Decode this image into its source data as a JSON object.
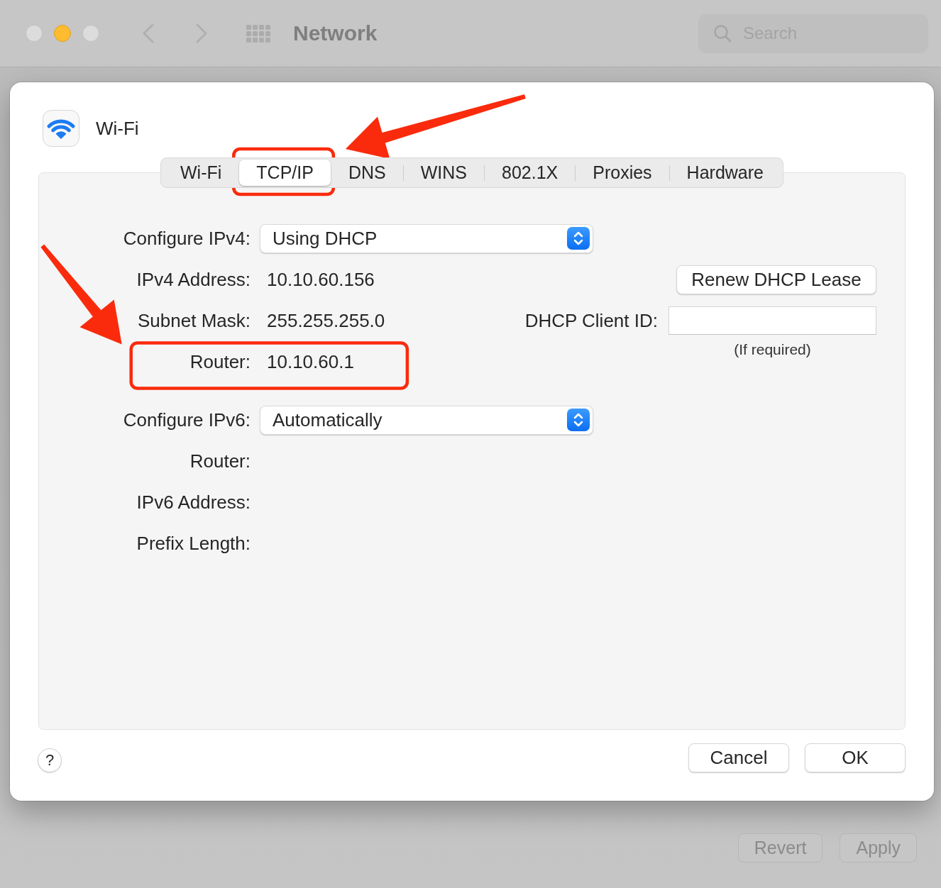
{
  "window": {
    "title": "Network",
    "controls": [
      {
        "kind": "close",
        "disabled": true
      },
      {
        "kind": "minimize",
        "disabled": false
      },
      {
        "kind": "zoom",
        "disabled": true
      }
    ],
    "navigation": [
      {
        "kind": "back",
        "disabled": true
      },
      {
        "kind": "forward",
        "disabled": true
      }
    ],
    "search": {
      "placeholder": "Search"
    }
  },
  "sheet": {
    "title": "Wi-Fi",
    "tabs": [
      {
        "label": "Wi-Fi",
        "selected": false,
        "highlighted": false
      },
      {
        "label": "TCP/IP",
        "selected": true,
        "highlighted": true
      },
      {
        "label": "DNS",
        "selected": false,
        "highlighted": false
      },
      {
        "label": "WINS",
        "selected": false,
        "highlighted": false
      },
      {
        "label": "802.1X",
        "selected": false,
        "highlighted": false
      },
      {
        "label": "Proxies",
        "selected": false,
        "highlighted": false
      },
      {
        "label": "Hardware",
        "selected": false,
        "highlighted": false
      }
    ],
    "ipv4": {
      "rows": [
        {
          "kind": "popup",
          "label": "Configure IPv4:",
          "value": "Using DHCP",
          "highlighted": false
        },
        {
          "kind": "text",
          "label": "IPv4 Address:",
          "value": "10.10.60.156",
          "highlighted": false
        },
        {
          "kind": "text",
          "label": "Subnet Mask:",
          "value": "255.255.255.0",
          "highlighted": false
        },
        {
          "kind": "text",
          "label": "Router:",
          "value": "10.10.60.1",
          "highlighted": true
        }
      ],
      "renew_button": "Renew DHCP Lease",
      "client_id": {
        "label": "DHCP Client ID:",
        "caption": "(If required)"
      }
    },
    "ipv6": {
      "rows": [
        {
          "kind": "popup",
          "label": "Configure IPv6:",
          "value": "Automatically",
          "highlighted": false
        },
        {
          "kind": "text",
          "label": "Router:",
          "highlighted": false
        },
        {
          "kind": "text",
          "label": "IPv6 Address:",
          "highlighted": false
        },
        {
          "kind": "text",
          "label": "Prefix Length:",
          "highlighted": false
        }
      ]
    },
    "help_button": "?",
    "buttons": [
      {
        "label": "Cancel"
      },
      {
        "label": "OK"
      }
    ]
  },
  "footer_buttons": [
    {
      "label": "Revert",
      "disabled": true
    },
    {
      "label": "Apply",
      "disabled": true
    }
  ]
}
